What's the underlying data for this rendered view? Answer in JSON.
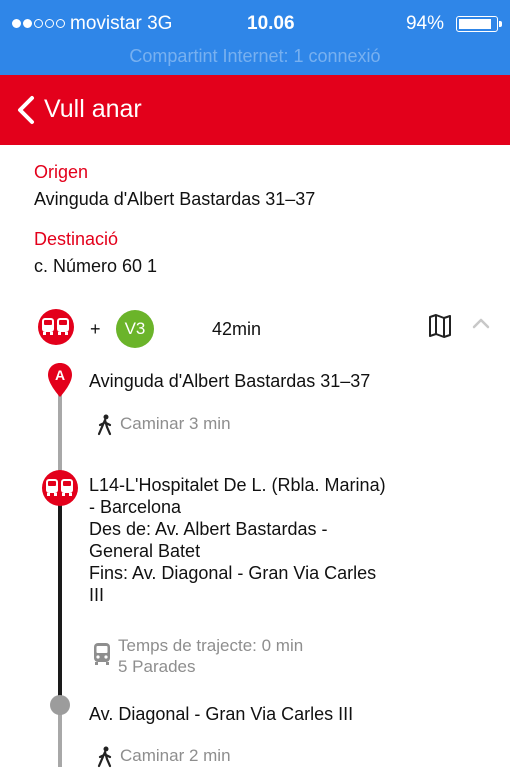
{
  "status_bar": {
    "carrier": "movistar  3G",
    "time": "10.06",
    "battery": "94%",
    "battery_level": 0.94,
    "signal_dots_filled": 2,
    "signal_dots_total": 5,
    "hotspot": "Compartint Internet: 1 connexió"
  },
  "nav": {
    "title": "Vull anar",
    "back_icon": "chevron-left-icon"
  },
  "trip": {
    "origin_label": "Origen",
    "origin_value": "Avinguda d'Albert Bastardas 31–37",
    "destination_label": "Destinació",
    "destination_value": "c.  Número 60 1"
  },
  "route": {
    "plus": "+",
    "line_badge": "V3",
    "duration": "42min",
    "icons": [
      "bus-icon",
      "map-icon",
      "chevron-up-icon"
    ]
  },
  "steps": {
    "start_marker": "A",
    "start_address": "Avinguda d'Albert Bastardas 31–37",
    "walk_1": "Caminar 3 min",
    "bus_line": "L14-L'Hospitalet De L. (Rbla. Marina) - Barcelona",
    "bus_line_l1": "L14-L'Hospitalet De L. (Rbla. Marina)",
    "bus_line_l2": "- Barcelona",
    "from_l1": "Des de: Av. Albert Bastardas -",
    "from_l2": "General Batet",
    "to_l1": "Fins: Av. Diagonal - Gran Via Carles",
    "to_l2": "III",
    "trip_time": "Temps de trajecte: 0 min",
    "stops": "5 Parades",
    "stop_name": "Av. Diagonal - Gran Via Carles III",
    "walk_2": "Caminar 2 min"
  },
  "colors": {
    "status_bar": "#2f86e8",
    "nav_red": "#e3001b",
    "v3_green": "#6bb42a",
    "muted_text": "#8e8e8e"
  }
}
